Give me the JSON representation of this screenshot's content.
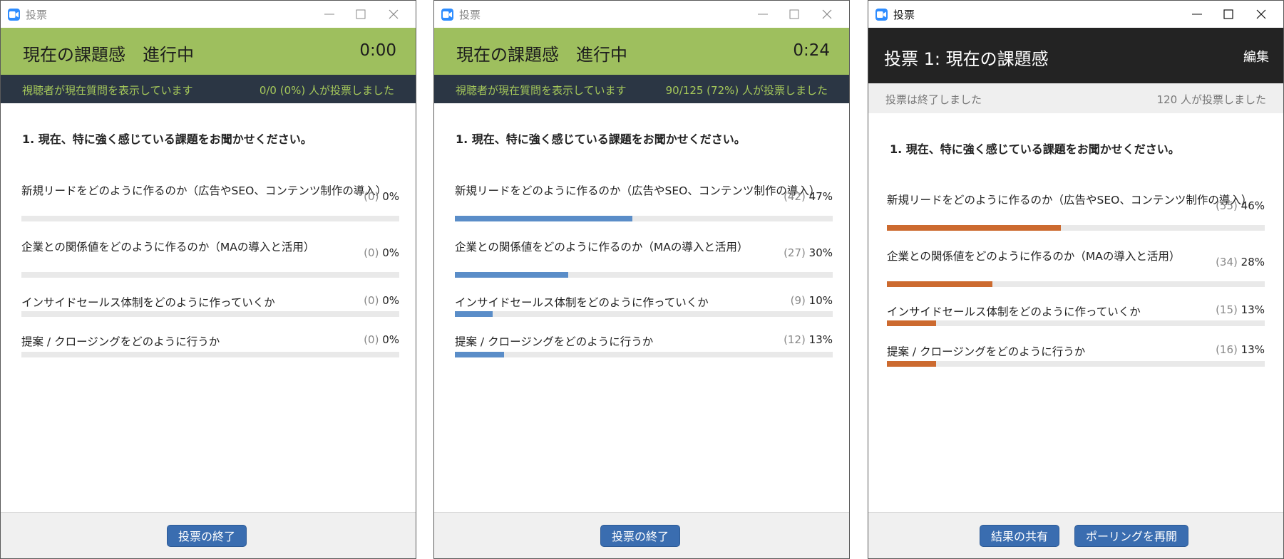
{
  "windows": [
    {
      "title": "投票",
      "header_title": "現在の課題感　進行中",
      "timer": "0:00",
      "status_left": "視聴者が現在質問を表示しています",
      "status_right": "0/0 (0%) 人が投票しました",
      "question": "1. 現在、特に強く感じている課題をお聞かせください。",
      "options": [
        {
          "label": "新規リードをどのように作るのか（広告やSEO、コンテンツ制作の導入）",
          "count": "(0)",
          "pct": "0%",
          "fraction": 0
        },
        {
          "label": "企業との関係値をどのように作るのか（MAの導入と活用）",
          "count": "(0)",
          "pct": "0%",
          "fraction": 0
        },
        {
          "label": "インサイドセールス体制をどのように作っていくか",
          "count": "(0)",
          "pct": "0%",
          "fraction": 0
        },
        {
          "label": "提案 / クロージングをどのように行うか",
          "count": "(0)",
          "pct": "0%",
          "fraction": 0
        }
      ],
      "end_button": "投票の終了"
    },
    {
      "title": "投票",
      "header_title": "現在の課題感　進行中",
      "timer": "0:24",
      "status_left": "視聴者が現在質問を表示しています",
      "status_right": "90/125 (72%) 人が投票しました",
      "question": "1. 現在、特に強く感じている課題をお聞かせください。",
      "options": [
        {
          "label": "新規リードをどのように作るのか（広告やSEO、コンテンツ制作の導入）",
          "count": "(42)",
          "pct": "47%",
          "fraction": 0.47
        },
        {
          "label": "企業との関係値をどのように作るのか（MAの導入と活用）",
          "count": "(27)",
          "pct": "30%",
          "fraction": 0.3
        },
        {
          "label": "インサイドセールス体制をどのように作っていくか",
          "count": "(9)",
          "pct": "10%",
          "fraction": 0.1
        },
        {
          "label": "提案 / クロージングをどのように行うか",
          "count": "(12)",
          "pct": "13%",
          "fraction": 0.13
        }
      ],
      "end_button": "投票の終了",
      "bar_color": "#5a8dc8"
    },
    {
      "title": "投票",
      "header_title": "投票 1: 現在の課題感",
      "edit_label": "編集",
      "status_left": "投票は終了しました",
      "status_right": "120 人が投票しました",
      "question": "1. 現在、特に強く感じている課題をお聞かせください。",
      "options": [
        {
          "label": "新規リードをどのように作るのか（広告やSEO、コンテンツ制作の導入）",
          "count": "(55)",
          "pct": "46%",
          "fraction": 0.46
        },
        {
          "label": "企業との関係値をどのように作るのか（MAの導入と活用）",
          "count": "(34)",
          "pct": "28%",
          "fraction": 0.28
        },
        {
          "label": "インサイドセールス体制をどのように作っていくか",
          "count": "(15)",
          "pct": "13%",
          "fraction": 0.13
        },
        {
          "label": "提案 / クロージングをどのように行うか",
          "count": "(16)",
          "pct": "13%",
          "fraction": 0.13
        }
      ],
      "share_button": "結果の共有",
      "restart_button": "ポーリングを再開",
      "bar_color": "#cc6a2f"
    }
  ],
  "colors": {
    "header_green": "#9ebf5e",
    "status_navy": "#2b3644",
    "status_text_green": "#a6c95a",
    "header_dark": "#232323",
    "button_blue": "#3a6db0"
  },
  "icons": [
    "zoom-camera-icon",
    "minimize-icon",
    "maximize-icon",
    "close-icon"
  ]
}
